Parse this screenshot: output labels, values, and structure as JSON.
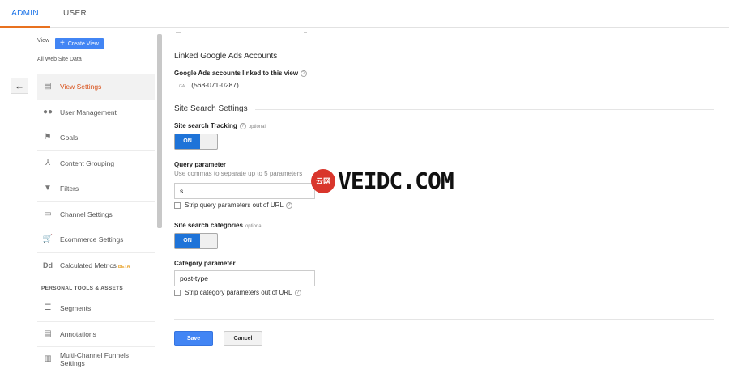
{
  "topbar": {
    "tabs": [
      "ADMIN",
      "USER"
    ]
  },
  "left": {
    "view_label": "View",
    "create_view": "Create View",
    "view_name": "All Web Site Data",
    "nav": [
      {
        "label": "View Settings",
        "icon": "document-icon",
        "glyph": "▤"
      },
      {
        "label": "User Management",
        "icon": "users-icon",
        "glyph": "●●"
      },
      {
        "label": "Goals",
        "icon": "flag-icon",
        "glyph": "⚑"
      },
      {
        "label": "Content Grouping",
        "icon": "person-icon",
        "glyph": "⅄"
      },
      {
        "label": "Filters",
        "icon": "filter-icon",
        "glyph": "▼"
      },
      {
        "label": "Channel Settings",
        "icon": "channel-icon",
        "glyph": "▭"
      },
      {
        "label": "Ecommerce Settings",
        "icon": "cart-icon",
        "glyph": "🛒"
      },
      {
        "label": "Calculated Metrics",
        "badge": "BETA",
        "icon": "dd-icon",
        "glyph": "Dd"
      }
    ],
    "section_header": "PERSONAL TOOLS & ASSETS",
    "tools": [
      {
        "label": "Segments",
        "icon": "segments-icon",
        "glyph": "☰"
      },
      {
        "label": "Annotations",
        "icon": "comment-icon",
        "glyph": "▤"
      },
      {
        "label": "Multi-Channel Funnels Settings",
        "icon": "bar-chart-icon",
        "glyph": "▥"
      }
    ]
  },
  "main": {
    "linked_title": "Linked Google Ads Accounts",
    "linked_label": "Google Ads accounts linked to this view",
    "ga_badge": "GA",
    "phone": "(568-071-0287)",
    "site_search_title": "Site Search Settings",
    "tracking_label": "Site search Tracking",
    "optional": "optional",
    "toggle_on": "ON",
    "query_label": "Query parameter",
    "query_hint": "Use commas to separate up to 5 parameters",
    "query_value": "s",
    "strip_query": "Strip query parameters out of URL",
    "categories_label": "Site search categories",
    "category_param_label": "Category parameter",
    "category_value": "post-type",
    "strip_category": "Strip category parameters out of URL",
    "save": "Save",
    "cancel": "Cancel"
  },
  "watermark": {
    "seal": "云网",
    "text": "VEIDC.COM"
  },
  "colors": {
    "accent_blue": "#4285f4",
    "toggle_blue": "#1e73d8",
    "active_orange": "#d9541e"
  }
}
